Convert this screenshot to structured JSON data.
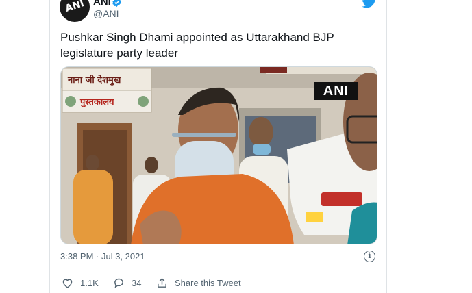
{
  "author": {
    "display_name": "ANI",
    "handle": "@ANI",
    "avatar_text": "ANI",
    "verified": true
  },
  "tweet": {
    "text": "Pushkar Singh Dhami appointed as Uttarakhand BJP legislature party leader",
    "timestamp": "3:38 PM · Jul 3, 2021"
  },
  "media": {
    "watermark": "ANI",
    "signboard_top": "नाना जी देशमुख",
    "signboard_bottom": "पुस्तकालय"
  },
  "actions": {
    "like_count": "1.1K",
    "reply_count": "34",
    "share_label": "Share this Tweet"
  },
  "colors": {
    "brand_blue": "#1d9bf0",
    "muted_text": "#536471",
    "kurta_orange": "#e0702a"
  },
  "icons": [
    "twitter-bird-icon",
    "verified-badge-icon",
    "info-icon",
    "heart-icon",
    "reply-icon",
    "share-icon"
  ]
}
